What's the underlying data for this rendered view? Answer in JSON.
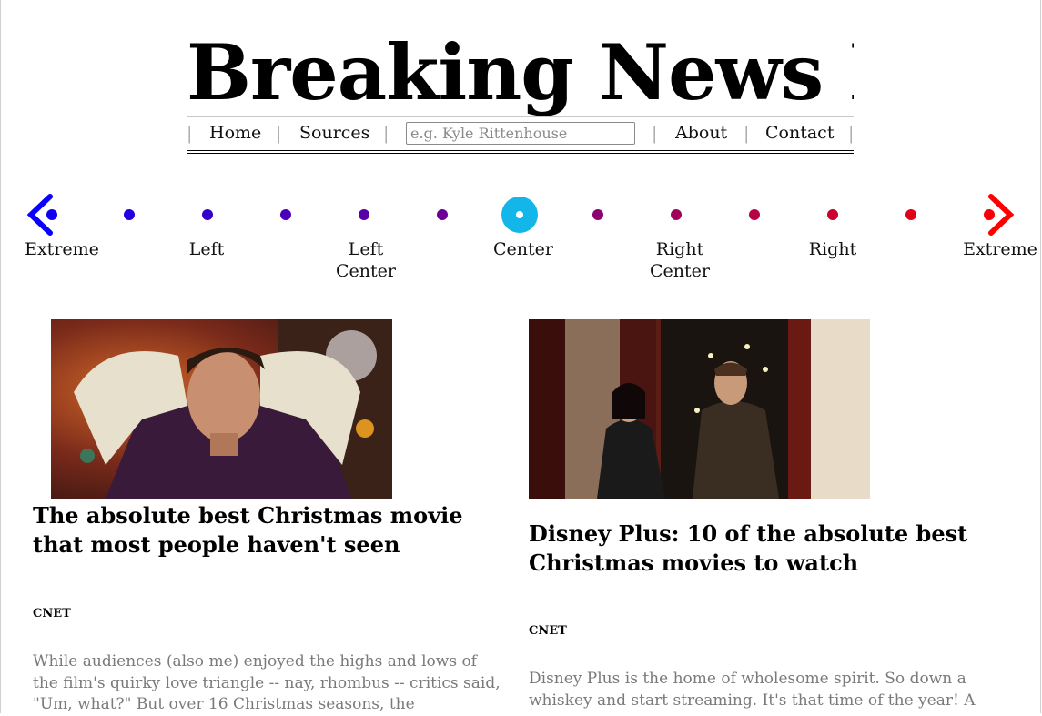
{
  "site": {
    "title": "Breaking News Bot"
  },
  "nav": {
    "home": "Home",
    "sources": "Sources",
    "search_placeholder": "e.g. Kyle Rittenhouse",
    "search_value": "",
    "about": "About",
    "contact": "Contact"
  },
  "spectrum": {
    "labels": [
      {
        "line1": "Extreme",
        "line2": ""
      },
      {
        "line1": "Left",
        "line2": ""
      },
      {
        "line1": "Left",
        "line2": "Center"
      },
      {
        "line1": "Center",
        "line2": ""
      },
      {
        "line1": "Right",
        "line2": "Center"
      },
      {
        "line1": "Right",
        "line2": ""
      },
      {
        "line1": "Extreme",
        "line2": ""
      }
    ],
    "selected": "Center",
    "colors": {
      "left": "#0a00ff",
      "right": "#ff0000",
      "selected": "#12b6e8"
    }
  },
  "articles": [
    {
      "headline": "The absolute best Christmas movie that most people haven't seen",
      "source": "CNET",
      "summary": "While audiences (also me) enjoyed the highs and lows of the film's quirky love triangle -- nay, rhombus -- critics said, \"Um, what?\" But over 16 Christmas seasons, the"
    },
    {
      "headline": "Disney Plus: 10 of the absolute best Christmas movies to watch",
      "source": "CNET",
      "summary": "Disney Plus is the home of wholesome spirit. So down a whiskey and start streaming. It's that time of the year! A"
    }
  ]
}
